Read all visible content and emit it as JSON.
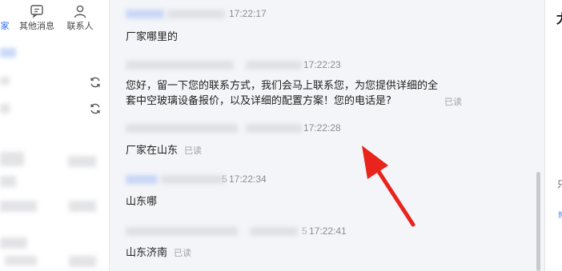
{
  "tabs": {
    "partial_label": "家",
    "other_messages": "其他消息",
    "contacts": "联系人"
  },
  "messages": [
    {
      "time": "17:22:17",
      "text": "厂家哪里的"
    },
    {
      "time": "17:22:23",
      "line1": "您好，留一下您的联系方式，我们会马上联系您，为您提供详细的全",
      "line2": "套中空玻璃设备报价，以及详细的配置方案！您的电话是?",
      "read": "已读"
    },
    {
      "time": "17:22:28",
      "text": "厂家在山东",
      "read": "已读"
    },
    {
      "time_prefix": "5",
      "time": "17:22:34",
      "text": "山东哪"
    },
    {
      "time_prefix": "5",
      "time": "17:22:41",
      "text": "山东济南",
      "read": "已读"
    }
  ],
  "right_panel": {
    "title_glyph": "尤",
    "mid_glyph": "只",
    "link_glyph": "热"
  },
  "colors": {
    "accent": "#2f6ff0",
    "annotation_arrow": "#e8241d"
  },
  "icons": [
    "chat-bubble-icon",
    "person-icon",
    "refresh-icon"
  ]
}
